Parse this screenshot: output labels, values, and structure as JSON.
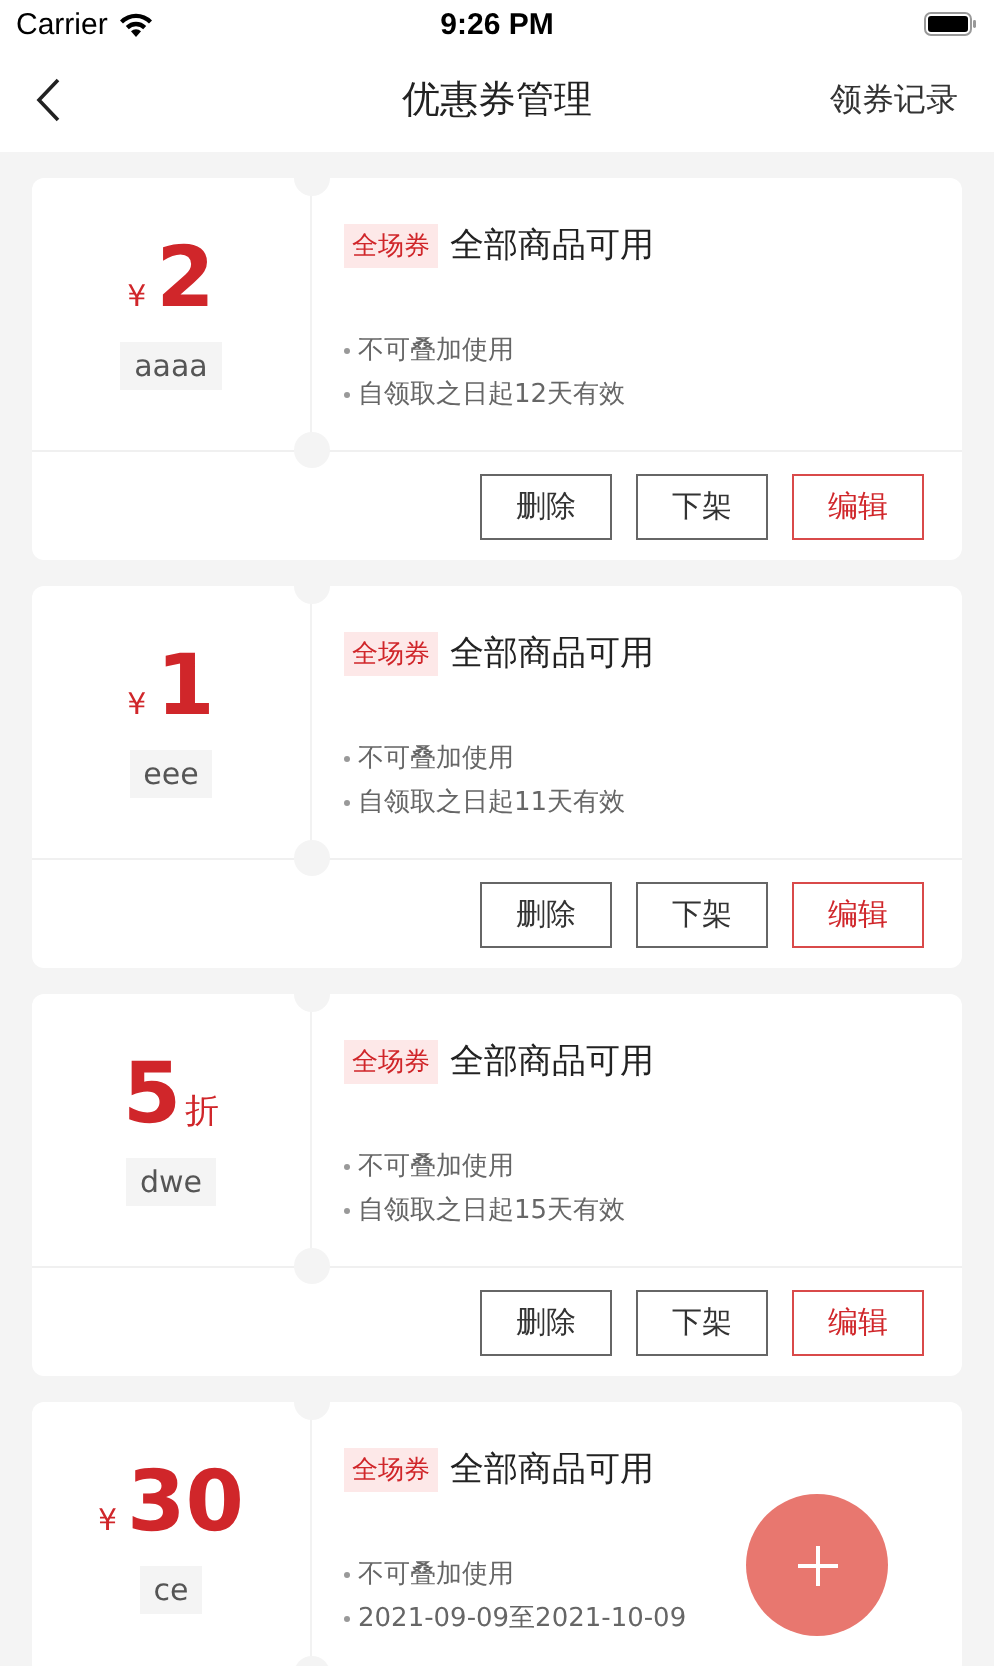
{
  "status_bar": {
    "carrier": "Carrier",
    "time": "9:26 PM"
  },
  "nav": {
    "title": "优惠券管理",
    "action": "领券记录"
  },
  "coupons": [
    {
      "kind": "cash",
      "currency": "¥",
      "amount": "2",
      "name": "aaaa",
      "tag": "全场券",
      "title": "全部商品可用",
      "rules": [
        "不可叠加使用",
        "自领取之日起12天有效"
      ],
      "buttons": [
        "删除",
        "下架",
        "编辑"
      ]
    },
    {
      "kind": "cash",
      "currency": "¥",
      "amount": "1",
      "name": "eee",
      "tag": "全场券",
      "title": "全部商品可用",
      "rules": [
        "不可叠加使用",
        "自领取之日起11天有效"
      ],
      "buttons": [
        "删除",
        "下架",
        "编辑"
      ]
    },
    {
      "kind": "discount",
      "amount": "5",
      "unit": "折",
      "name": "dwe",
      "tag": "全场券",
      "title": "全部商品可用",
      "rules": [
        "不可叠加使用",
        "自领取之日起15天有效"
      ],
      "buttons": [
        "删除",
        "下架",
        "编辑"
      ]
    },
    {
      "kind": "cash",
      "currency": "¥",
      "amount": "30",
      "name": "ce",
      "tag": "全场券",
      "title": "全部商品可用",
      "rules": [
        "不可叠加使用",
        "2021-09-09至2021-10-09"
      ]
    }
  ]
}
